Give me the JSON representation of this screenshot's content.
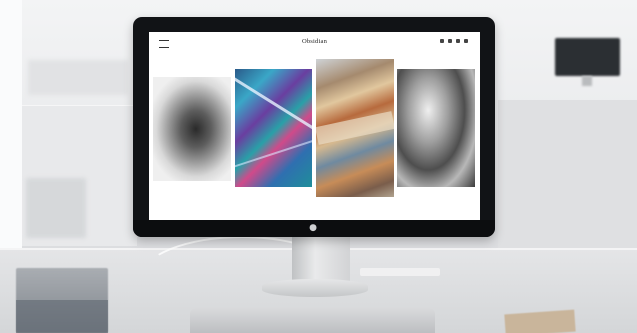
{
  "site": {
    "title": "Obsidian",
    "social_icons": [
      "twitter-icon",
      "instagram-icon",
      "linkedin-icon",
      "share-icon"
    ],
    "menu_icon": "hamburger-icon"
  },
  "gallery": [
    {
      "name": "gray-crystal-cluster"
    },
    {
      "name": "blue-violet-mineral"
    },
    {
      "name": "ochre-agate-slice"
    },
    {
      "name": "monochrome-geode"
    }
  ],
  "colors": {
    "bezel": "#111316",
    "screen_bg": "#ffffff",
    "desk": "#d4d6d8"
  }
}
